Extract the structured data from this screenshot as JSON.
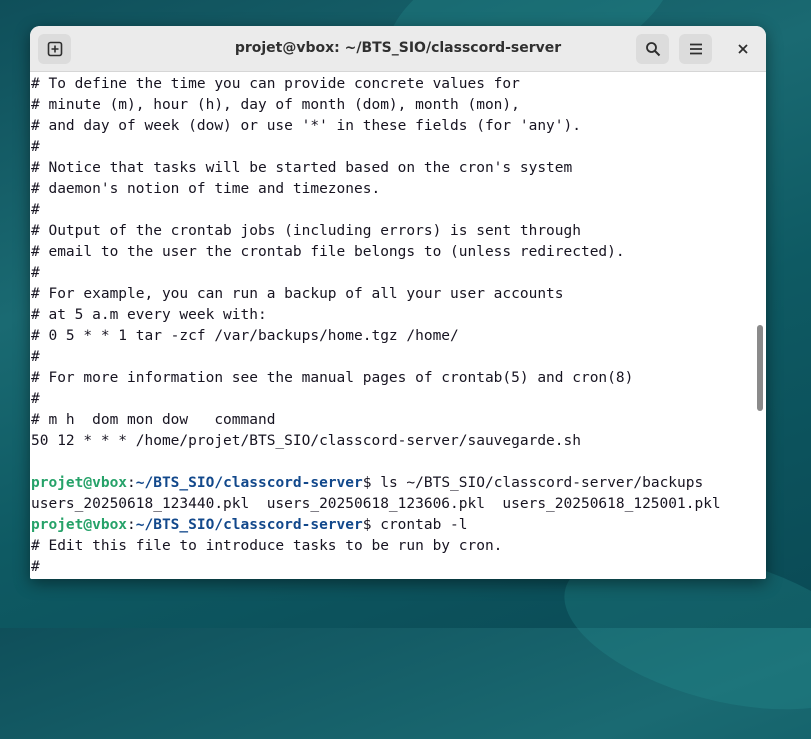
{
  "window": {
    "title": "projet@vbox: ~/BTS_SIO/classcord-server"
  },
  "icons": {
    "new_tab": "new-tab-icon",
    "search": "search-icon",
    "menu": "hamburger-menu-icon",
    "close": "close-icon"
  },
  "colors": {
    "prompt_user": "#26a269",
    "prompt_path": "#12488b",
    "text": "#171421",
    "headerbar": "#ebebeb"
  },
  "scrollbar": {
    "visible_fraction": 0.17,
    "position_fraction": 0.6
  },
  "terminal": {
    "lines": [
      {
        "text": "# To define the time you can provide concrete values for"
      },
      {
        "text": "# minute (m), hour (h), day of month (dom), month (mon),"
      },
      {
        "text": "# and day of week (dow) or use '*' in these fields (for 'any')."
      },
      {
        "text": "#"
      },
      {
        "text": "# Notice that tasks will be started based on the cron's system"
      },
      {
        "text": "# daemon's notion of time and timezones."
      },
      {
        "text": "#"
      },
      {
        "text": "# Output of the crontab jobs (including errors) is sent through"
      },
      {
        "text": "# email to the user the crontab file belongs to (unless redirected)."
      },
      {
        "text": "#"
      },
      {
        "text": "# For example, you can run a backup of all your user accounts"
      },
      {
        "text": "# at 5 a.m every week with:"
      },
      {
        "text": "# 0 5 * * 1 tar -zcf /var/backups/home.tgz /home/"
      },
      {
        "text": "#"
      },
      {
        "text": "# For more information see the manual pages of crontab(5) and cron(8)"
      },
      {
        "text": "#"
      },
      {
        "text": "# m h  dom mon dow   command"
      },
      {
        "text": "50 12 * * * /home/projet/BTS_SIO/classcord-server/sauvegarde.sh"
      },
      {
        "text": ""
      },
      {
        "user": "projet@vbox",
        "sep": ":",
        "path": "~/BTS_SIO/classcord-server",
        "dollar": "$ ",
        "cmd": "ls ~/BTS_SIO/classcord-server/backups"
      },
      {
        "text": "users_20250618_123440.pkl  users_20250618_123606.pkl  users_20250618_125001.pkl"
      },
      {
        "user": "projet@vbox",
        "sep": ":",
        "path": "~/BTS_SIO/classcord-server",
        "dollar": "$ ",
        "cmd": "crontab -l"
      },
      {
        "text": "# Edit this file to introduce tasks to be run by cron."
      },
      {
        "text": "#"
      }
    ]
  }
}
